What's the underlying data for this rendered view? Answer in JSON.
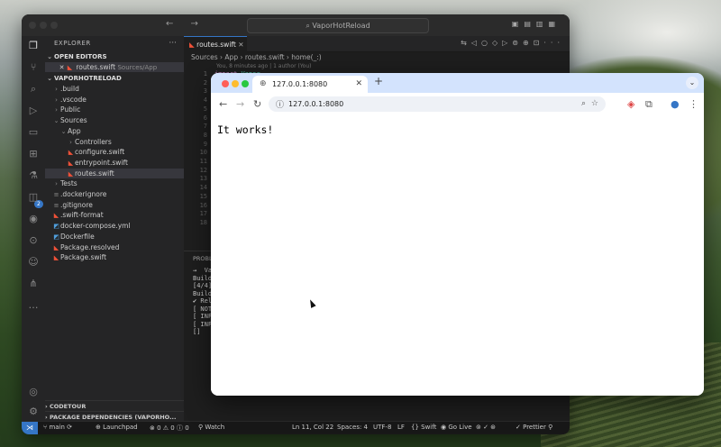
{
  "vscode": {
    "title": "VaporHotReload",
    "nav_arrows": "←  →",
    "explorer": {
      "header": "EXPLORER",
      "open_editors": "OPEN EDITORS",
      "open_file": "routes.swift",
      "open_file_path": "Sources/App",
      "project": "VAPORHOTRELOAD",
      "tree": [
        {
          "label": ".build",
          "kind": "folder"
        },
        {
          "label": ".vscode",
          "kind": "folder"
        },
        {
          "label": "Public",
          "kind": "folder"
        },
        {
          "label": "Sources",
          "kind": "folder-open"
        },
        {
          "label": "App",
          "kind": "folder-open"
        },
        {
          "label": "Controllers",
          "kind": "folder"
        },
        {
          "label": "configure.swift",
          "kind": "swift"
        },
        {
          "label": "entrypoint.swift",
          "kind": "swift"
        },
        {
          "label": "routes.swift",
          "kind": "swift"
        },
        {
          "label": "Tests",
          "kind": "folder"
        },
        {
          "label": ".dockerignore",
          "kind": "file"
        },
        {
          "label": ".gitignore",
          "kind": "file"
        },
        {
          "label": ".swift-format",
          "kind": "swift"
        },
        {
          "label": "docker-compose.yml",
          "kind": "docker"
        },
        {
          "label": "Dockerfile",
          "kind": "docker"
        },
        {
          "label": "Package.resolved",
          "kind": "swift"
        },
        {
          "label": "Package.swift",
          "kind": "swift"
        }
      ],
      "codetour": "CODETOUR",
      "package_deps": "PACKAGE DEPENDENCIES (VAPORHO..."
    },
    "activity_badge": "2",
    "editor": {
      "tab": "routes.swift",
      "breadcrumbs": "Sources › App › routes.swift › home(_:)",
      "blame": "You, 8 minutes ago | 1 author (You)",
      "line_numbers": [
        "1",
        "2",
        "3",
        "4",
        "5",
        "6",
        "7",
        "8",
        "9",
        "10",
        "11",
        "12",
        "13",
        "14",
        "15",
        "16",
        "17",
        "18"
      ],
      "panel_tab": "PROBLEMS",
      "terminal_lines": [
        "→  VaporHotRe",
        "Building for",
        "[4/4] Compil",
        "Build of pro",
        "✔ Reloader",
        "[ NOTICE ] S",
        "[ INFO ] GET",
        "[ INFO ] GET",
        "[]"
      ]
    },
    "status": {
      "branch": "main",
      "launchpad": "Launchpad",
      "errors": "0",
      "warnings": "0",
      "info": "0",
      "watch": "Watch",
      "position": "Ln 11, Col 22",
      "spaces": "Spaces: 4",
      "encoding": "UTF-8",
      "eol": "LF",
      "language": "Swift",
      "golive": "Go Live",
      "prettier": "Prettier"
    }
  },
  "chrome": {
    "tab_title": "127.0.0.1:8080",
    "url": "127.0.0.1:8080",
    "page_text": "It works!"
  }
}
